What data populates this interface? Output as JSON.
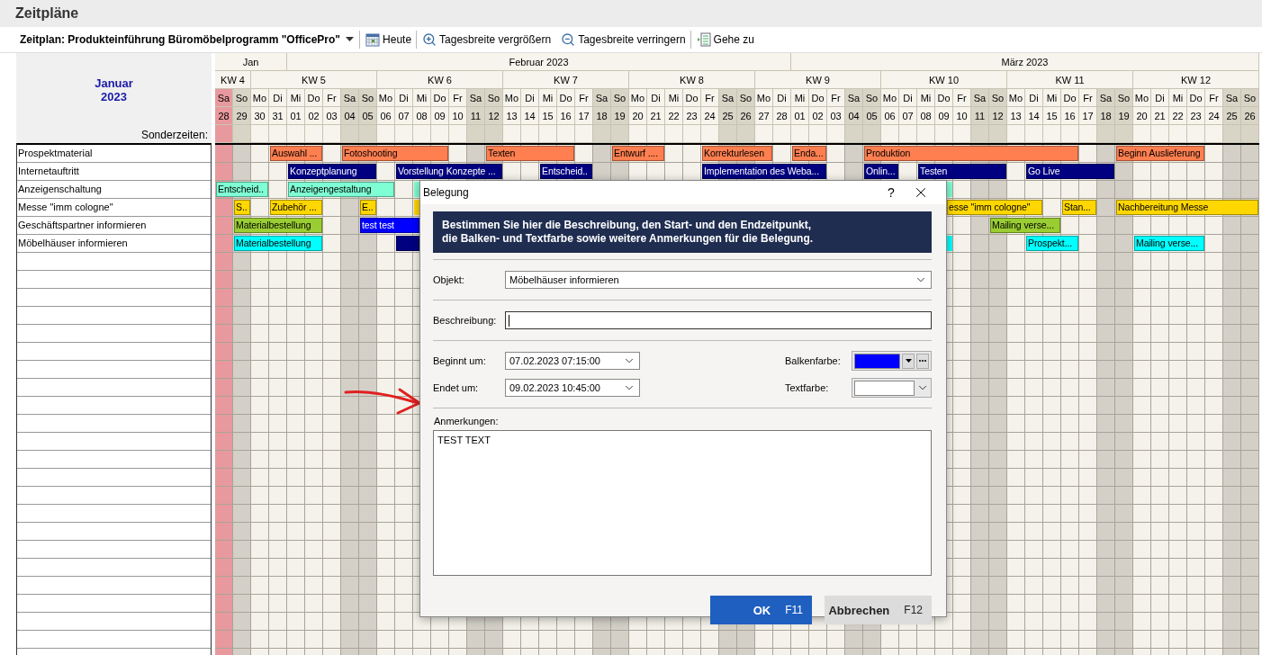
{
  "page_title": "Zeitpläne",
  "toolbar": {
    "schedule": "Zeitplan: Produkteinführung Büromöbelprogramm \"OfficePro\"",
    "buttons": [
      {
        "kind": "today",
        "label": "Heute"
      },
      {
        "kind": "zoom_in",
        "label": "Tagesbreite vergrößern"
      },
      {
        "kind": "zoom_out",
        "label": "Tagesbreite verringern"
      },
      {
        "kind": "goto",
        "label": "Gehe zu"
      }
    ]
  },
  "calendar": {
    "month_title": "Januar",
    "year": "2023",
    "special_label": "Sonderzeiten:",
    "months": [
      {
        "label": "Jan"
      },
      {
        "label": "Februar 2023"
      },
      {
        "label": "März 2023"
      }
    ],
    "weeks": [
      {
        "label": "KW 4",
        "days": [
          {
            "weekday": "Sa",
            "day": "28",
            "weekend": true,
            "marked": true
          },
          {
            "weekday": "So",
            "day": "29",
            "weekend": true,
            "marked": false
          }
        ]
      },
      {
        "label": "KW 5",
        "days": [
          {
            "weekday": "Mo",
            "day": "30",
            "weekend": false,
            "marked": false
          },
          {
            "weekday": "Di",
            "day": "31",
            "weekend": false,
            "marked": false
          },
          {
            "weekday": "Mi",
            "day": "01",
            "weekend": false,
            "marked": false
          },
          {
            "weekday": "Do",
            "day": "02",
            "weekend": false,
            "marked": false
          },
          {
            "weekday": "Fr",
            "day": "03",
            "weekend": false,
            "marked": false
          },
          {
            "weekday": "Sa",
            "day": "04",
            "weekend": true,
            "marked": false
          },
          {
            "weekday": "So",
            "day": "05",
            "weekend": true,
            "marked": false
          }
        ]
      },
      {
        "label": "KW 6",
        "days": [
          {
            "weekday": "Mo",
            "day": "06",
            "weekend": false,
            "marked": false
          },
          {
            "weekday": "Di",
            "day": "07",
            "weekend": false,
            "marked": false
          },
          {
            "weekday": "Mi",
            "day": "08",
            "weekend": false,
            "marked": false
          },
          {
            "weekday": "Do",
            "day": "09",
            "weekend": false,
            "marked": false
          },
          {
            "weekday": "Fr",
            "day": "10",
            "weekend": false,
            "marked": false
          },
          {
            "weekday": "Sa",
            "day": "11",
            "weekend": true,
            "marked": false
          },
          {
            "weekday": "So",
            "day": "12",
            "weekend": true,
            "marked": false
          }
        ]
      },
      {
        "label": "KW 7",
        "days": [
          {
            "weekday": "Mo",
            "day": "13",
            "weekend": false,
            "marked": false
          },
          {
            "weekday": "Di",
            "day": "14",
            "weekend": false,
            "marked": false
          },
          {
            "weekday": "Mi",
            "day": "15",
            "weekend": false,
            "marked": false
          },
          {
            "weekday": "Do",
            "day": "16",
            "weekend": false,
            "marked": false
          },
          {
            "weekday": "Fr",
            "day": "17",
            "weekend": false,
            "marked": false
          },
          {
            "weekday": "Sa",
            "day": "18",
            "weekend": true,
            "marked": false
          },
          {
            "weekday": "So",
            "day": "19",
            "weekend": true,
            "marked": false
          }
        ]
      },
      {
        "label": "KW 8",
        "days": [
          {
            "weekday": "Mo",
            "day": "20",
            "weekend": false,
            "marked": false
          },
          {
            "weekday": "Di",
            "day": "21",
            "weekend": false,
            "marked": false
          },
          {
            "weekday": "Mi",
            "day": "22",
            "weekend": false,
            "marked": false
          },
          {
            "weekday": "Do",
            "day": "23",
            "weekend": false,
            "marked": false
          },
          {
            "weekday": "Fr",
            "day": "24",
            "weekend": false,
            "marked": false
          },
          {
            "weekday": "Sa",
            "day": "25",
            "weekend": true,
            "marked": false
          },
          {
            "weekday": "So",
            "day": "26",
            "weekend": true,
            "marked": false
          }
        ]
      },
      {
        "label": "KW 9",
        "days": [
          {
            "weekday": "Mo",
            "day": "27",
            "weekend": false,
            "marked": false
          },
          {
            "weekday": "Di",
            "day": "28",
            "weekend": false,
            "marked": false
          },
          {
            "weekday": "Mi",
            "day": "01",
            "weekend": false,
            "marked": false
          },
          {
            "weekday": "Do",
            "day": "02",
            "weekend": false,
            "marked": false
          },
          {
            "weekday": "Fr",
            "day": "03",
            "weekend": false,
            "marked": false
          },
          {
            "weekday": "Sa",
            "day": "04",
            "weekend": true,
            "marked": false
          },
          {
            "weekday": "So",
            "day": "05",
            "weekend": true,
            "marked": false
          }
        ]
      },
      {
        "label": "KW 10",
        "days": [
          {
            "weekday": "Mo",
            "day": "06",
            "weekend": false,
            "marked": false
          },
          {
            "weekday": "Di",
            "day": "07",
            "weekend": false,
            "marked": false
          },
          {
            "weekday": "Mi",
            "day": "08",
            "weekend": false,
            "marked": false
          },
          {
            "weekday": "Do",
            "day": "09",
            "weekend": false,
            "marked": false
          },
          {
            "weekday": "Fr",
            "day": "10",
            "weekend": false,
            "marked": false
          },
          {
            "weekday": "Sa",
            "day": "11",
            "weekend": true,
            "marked": false
          },
          {
            "weekday": "So",
            "day": "12",
            "weekend": true,
            "marked": false
          }
        ]
      },
      {
        "label": "KW 11",
        "days": [
          {
            "weekday": "Mo",
            "day": "13",
            "weekend": false,
            "marked": false
          },
          {
            "weekday": "Di",
            "day": "14",
            "weekend": false,
            "marked": false
          },
          {
            "weekday": "Mi",
            "day": "15",
            "weekend": false,
            "marked": false
          },
          {
            "weekday": "Do",
            "day": "16",
            "weekend": false,
            "marked": false
          },
          {
            "weekday": "Fr",
            "day": "17",
            "weekend": false,
            "marked": false
          },
          {
            "weekday": "Sa",
            "day": "18",
            "weekend": true,
            "marked": false
          },
          {
            "weekday": "So",
            "day": "19",
            "weekend": true,
            "marked": false
          }
        ]
      },
      {
        "label": "KW 12",
        "days": [
          {
            "weekday": "Mo",
            "day": "20",
            "weekend": false,
            "marked": false
          },
          {
            "weekday": "Di",
            "day": "21",
            "weekend": false,
            "marked": false
          },
          {
            "weekday": "Mi",
            "day": "22",
            "weekend": false,
            "marked": false
          },
          {
            "weekday": "Do",
            "day": "23",
            "weekend": false,
            "marked": false
          },
          {
            "weekday": "Fr",
            "day": "24",
            "weekend": false,
            "marked": false
          },
          {
            "weekday": "Sa",
            "day": "25",
            "weekend": true,
            "marked": false
          },
          {
            "weekday": "So",
            "day": "26",
            "weekend": true,
            "marked": false
          }
        ]
      }
    ],
    "rows": [
      {
        "label": "Prospektmaterial",
        "bars": [
          {
            "label": "Auswahl ...",
            "color": "#ff7f50"
          },
          {
            "label": "Fotoshooting",
            "color": "#ff7f50"
          },
          {
            "label": "Texten",
            "color": "#ff7f50"
          },
          {
            "label": "Entwurf ....",
            "color": "#ff7f50"
          },
          {
            "label": "Korrekturlesen",
            "color": "#ff7f50"
          },
          {
            "label": "Enda...",
            "color": "#ff7f50"
          },
          {
            "label": "Produktion",
            "color": "#ff7f50"
          },
          {
            "label": "Beginn Auslieferung",
            "color": "#ff7f50"
          }
        ]
      },
      {
        "label": "Internetauftritt",
        "bars": [
          {
            "label": "Konzeptplanung",
            "color": "#000080"
          },
          {
            "label": "Vorstellung Konzepte ...",
            "color": "#000080"
          },
          {
            "label": "Entscheid..",
            "color": "#000080"
          },
          {
            "label": "Implementation des Weba...",
            "color": "#000080"
          },
          {
            "label": "Onlin...",
            "color": "#000080"
          },
          {
            "label": "Testen",
            "color": "#000080"
          },
          {
            "label": "Go Live",
            "color": "#000080"
          }
        ]
      },
      {
        "label": "Anzeigenschaltung",
        "bars": [
          {
            "label": "Entscheid..",
            "color": "#7fffd4"
          },
          {
            "label": "Anzeigengestaltung",
            "color": "#7fffd4"
          },
          {
            "color": "#7fffd4"
          },
          {
            "color": "#7fffd4"
          }
        ]
      },
      {
        "label": "Messe \"imm cologne\"",
        "bars": [
          {
            "label": "S..",
            "color": "#ffd700"
          },
          {
            "label": "Zubehör ...",
            "color": "#ffd700"
          },
          {
            "label": "E..",
            "color": "#ffd700"
          },
          {
            "color": "#ffd700"
          },
          {
            "label": "esse \"imm cologne\"",
            "color": "#ffd700"
          },
          {
            "label": "Stan...",
            "color": "#ffd700"
          },
          {
            "label": "Nachbereitung Messe",
            "color": "#ffd700"
          }
        ]
      },
      {
        "label": "Geschäftspartner informieren",
        "bars": [
          {
            "label": "Materialbestellung",
            "color": "#9acd32"
          },
          {
            "label": "test test",
            "color": "#0000ff"
          },
          {
            "label": "Mailing verse...",
            "color": "#9acd32"
          }
        ]
      },
      {
        "label": "Möbelhäuser informieren",
        "bars": [
          {
            "label": "Materialbestellung",
            "color": "#00ffff"
          },
          {
            "color": "#000080"
          },
          {
            "color": "#00ffff"
          },
          {
            "label": "Prospekt...",
            "color": "#00ffff"
          },
          {
            "label": "Mailing verse...",
            "color": "#00ffff"
          }
        ]
      }
    ]
  },
  "dialog": {
    "title": "Belegung",
    "help": "?",
    "info_lines": [
      "Bestimmen Sie hier die Beschreibung, den Start- und den Endzeitpunkt,",
      "die Balken- und Textfarbe sowie weitere Anmerkungen für die Belegung."
    ],
    "object": {
      "label": "Objekt:",
      "value": "Möbelhäuser informieren"
    },
    "description": {
      "label": "Beschreibung:",
      "focused": true
    },
    "start": {
      "label": "Beginnt um:",
      "value": "07.02.2023 07:15:00"
    },
    "end": {
      "label": "Endet um:",
      "value": "09.02.2023 10:45:00"
    },
    "bar_color": {
      "label": "Balkenfarbe:",
      "color": "#0000ff"
    },
    "text_color": {
      "label": "Textfarbe:",
      "color": "#ffffff"
    },
    "notes": {
      "label": "Anmerkungen:",
      "value": "TEST TEXT"
    },
    "buttons": [
      {
        "label": "OK",
        "shortcut": "F11",
        "primary": true
      },
      {
        "label": "Abbrechen",
        "shortcut": "F12",
        "primary": false
      }
    ]
  }
}
